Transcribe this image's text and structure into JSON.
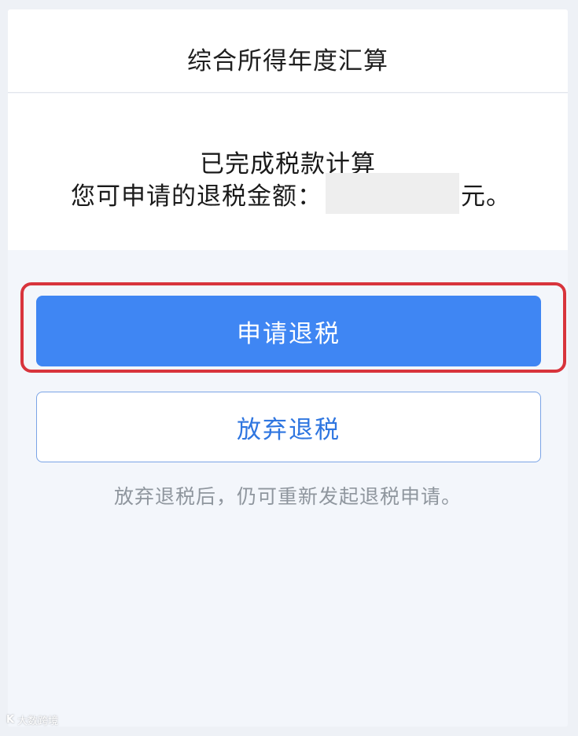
{
  "header": {
    "title": "综合所得年度汇算"
  },
  "result": {
    "status_text": "已完成税款计算",
    "refund_label": "您可申请的退税金额：",
    "refund_amount": "",
    "unit": "元。"
  },
  "actions": {
    "apply_label": "申请退税",
    "giveup_label": "放弃退税"
  },
  "note": "放弃退税后，仍可重新发起退税申请。",
  "watermark": {
    "logo_text": "K",
    "text": "大数跨境"
  },
  "colors": {
    "primary": "#3f86f3",
    "highlight": "#d8343c",
    "secondary_text": "#2f76e0",
    "muted_text": "#8f969e"
  }
}
